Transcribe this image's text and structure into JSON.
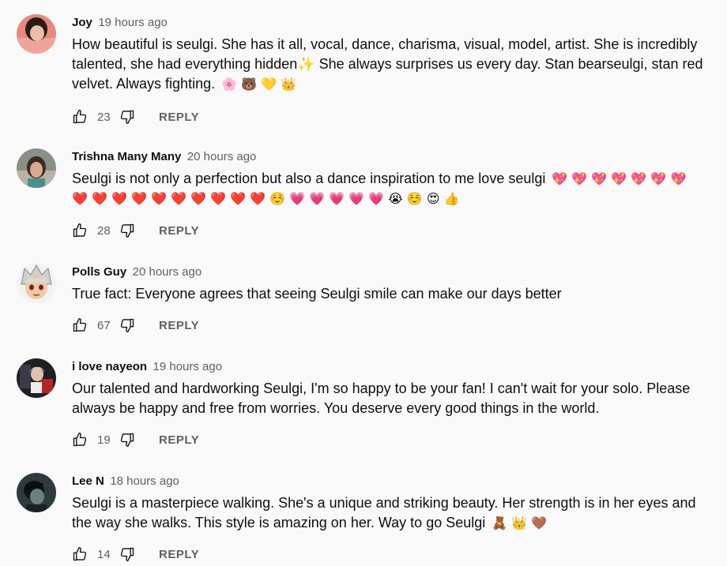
{
  "comments": [
    {
      "author": "Joy",
      "time": "19 hours ago",
      "text": "How beautiful is seulgi. She has it all, vocal, dance, charisma, visual, model, artist. She is incredibly talented, she had everything hidden✨ She always surprises us every day. Stan bearseulgi, stan red velvet. Always fighting.",
      "emojis": "🌸 🐻 💛 👑",
      "likes": "23",
      "reply": "REPLY"
    },
    {
      "author": "Trishna Many Many",
      "time": "20 hours ago",
      "text": "Seulgi is not only a perfection but also a dance inspiration to me love seulgi",
      "emojis": "💖 💖 💖 💖 💖 💖 💖 ❤️ ❤️ ❤️ ❤️ ❤️ ❤️ ❤️ ❤️ ❤️ ❤️ ☺️ 💗 💗 💗 💗 💗 😭 ☺️ 😍 👍",
      "likes": "28",
      "reply": "REPLY"
    },
    {
      "author": "Polls Guy",
      "time": "20 hours ago",
      "text": "True fact: Everyone agrees that seeing Seulgi smile can make our days better",
      "emojis": "",
      "likes": "67",
      "reply": "REPLY"
    },
    {
      "author": "i love nayeon",
      "time": "19 hours ago",
      "text": "Our talented and hardworking Seulgi, I'm so happy to be your fan! I can't wait for your solo. Please always be happy and free from worries. You deserve every good things in the world.",
      "emojis": "",
      "likes": "19",
      "reply": "REPLY"
    },
    {
      "author": "Lee N",
      "time": "18 hours ago",
      "text": "Seulgi is a masterpiece walking. She's a unique and striking beauty. Her strength is in her eyes and the way she walks. This style is amazing on her. Way to go Seulgi",
      "emojis": "🧸 👑 🤎",
      "likes": "14",
      "reply": "REPLY"
    }
  ],
  "icons": {
    "like": "thumbs-up-icon",
    "dislike": "thumbs-down-icon"
  },
  "colors": {
    "background": "#f9f9f9",
    "text": "#0f0f0f",
    "secondary": "#606060"
  }
}
